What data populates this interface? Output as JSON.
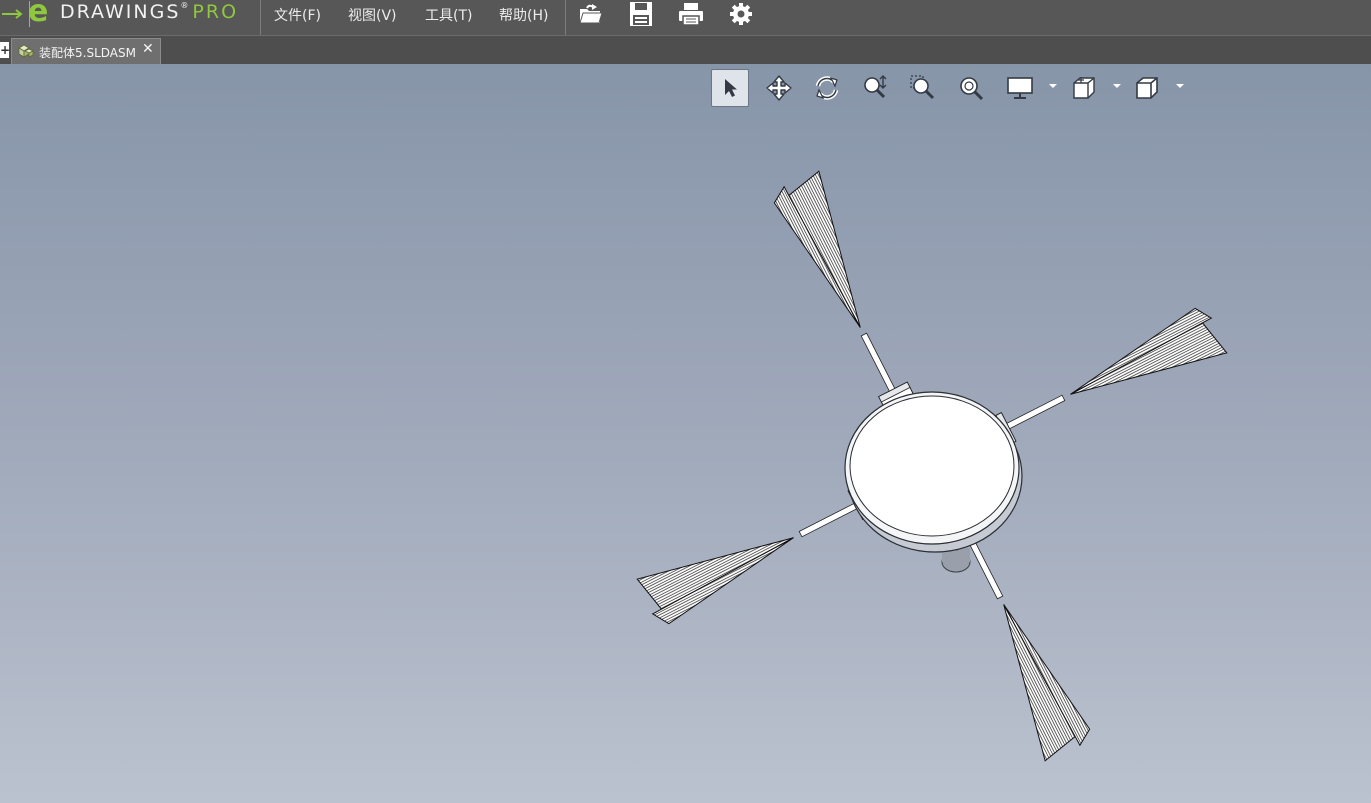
{
  "app": {
    "logo_text": "DRAWINGS",
    "logo_reg": "®",
    "logo_pro": "PRO"
  },
  "menu": {
    "file": "文件(F)",
    "view": "视图(V)",
    "tools": "工具(T)",
    "help": "帮助(H)"
  },
  "toolbar": {
    "icons": [
      "open-folder-icon",
      "save-icon",
      "print-icon",
      "settings-gear-icon"
    ]
  },
  "tab": {
    "plus": "+",
    "label": "装配体5.SLDASM",
    "close": "✕"
  },
  "view_toolbar": {
    "tools": [
      "select",
      "pan",
      "rotate",
      "zoom",
      "zoom-to-area",
      "zoom-to-fit",
      "display-style",
      "view-settings",
      "view-orientation"
    ],
    "active": "select"
  },
  "colors": {
    "accent": "#8fc73e",
    "viewport_top": "#8795a9",
    "viewport_bottom": "#bbc2cf"
  }
}
